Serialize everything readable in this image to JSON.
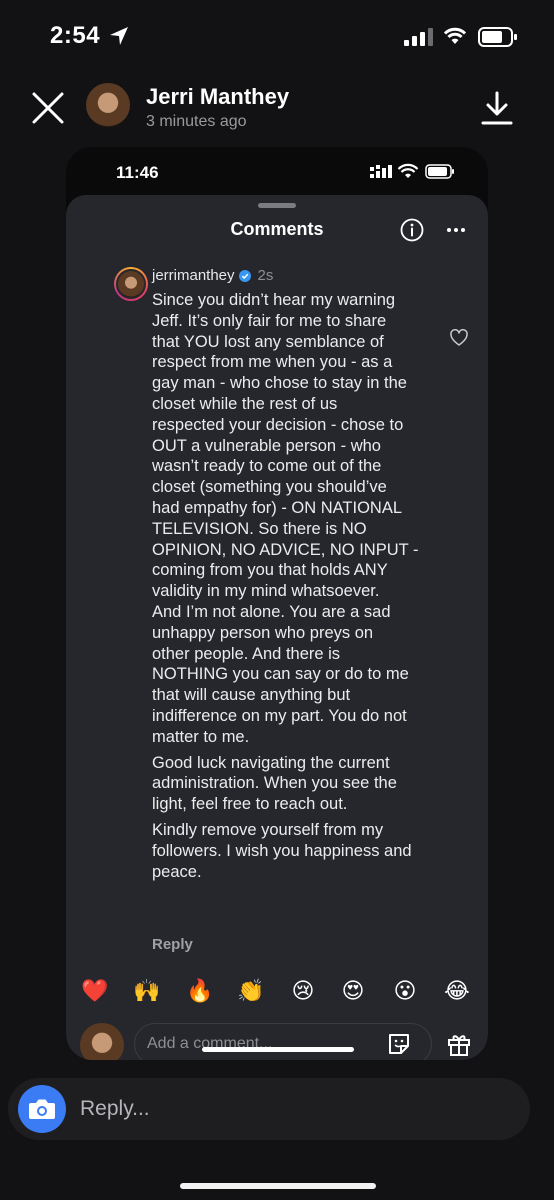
{
  "status_bar": {
    "time": "2:54"
  },
  "story_header": {
    "name": "Jerri Manthey",
    "time": "3 minutes ago"
  },
  "inner_status": {
    "time": "11:46"
  },
  "comments_sheet": {
    "title": "Comments"
  },
  "comment": {
    "username": "jerrimanthey",
    "time": "2s",
    "paragraphs": [
      [
        "Since you didn’t hear my warning",
        "Jeff. It’s only fair for me to share",
        "that YOU lost any semblance of",
        "respect from me when you - as a",
        "gay man - who chose to stay in the",
        "closet while the rest of us",
        "respected your decision - chose to",
        "OUT a vulnerable person - who",
        "wasn’t ready to come out of the",
        "closet (something you should’ve",
        "had empathy for) - ON NATIONAL",
        "TELEVISION. So there is NO",
        "OPINION, NO ADVICE, NO INPUT -",
        "coming from you that holds ANY",
        "validity in my mind whatsoever.",
        "And I’m not alone. You are a sad",
        "unhappy person who preys on",
        "other people. And there is",
        "NOTHING you can say or do to me",
        "that will cause anything but",
        "indifference on my part. You do not",
        "matter to me."
      ],
      [
        "Good luck navigating the current",
        "administration. When you see the",
        "light, feel free to reach out."
      ],
      [
        "Kindly remove yourself from my",
        "followers. I wish you happiness and",
        "peace."
      ]
    ],
    "reply_label": "Reply"
  },
  "emoji_reactions": [
    "❤️",
    "🙌",
    "🔥",
    "👏",
    "😢",
    "😍",
    "😮",
    "😂"
  ],
  "comment_input": {
    "placeholder": "Add a comment..."
  },
  "reply_bar": {
    "placeholder": "Reply..."
  },
  "colors": {
    "verified_blue": "#3897f0",
    "camera_blue": "#3b7cf5",
    "sheet_bg": "#26272c"
  },
  "icons": [
    "location-arrow-icon",
    "signal-icon",
    "wifi-icon",
    "battery-icon",
    "close-icon",
    "download-icon",
    "info-icon",
    "more-icon",
    "verified-badge-icon",
    "heart-icon",
    "sticker-icon",
    "gift-icon",
    "camera-icon"
  ]
}
